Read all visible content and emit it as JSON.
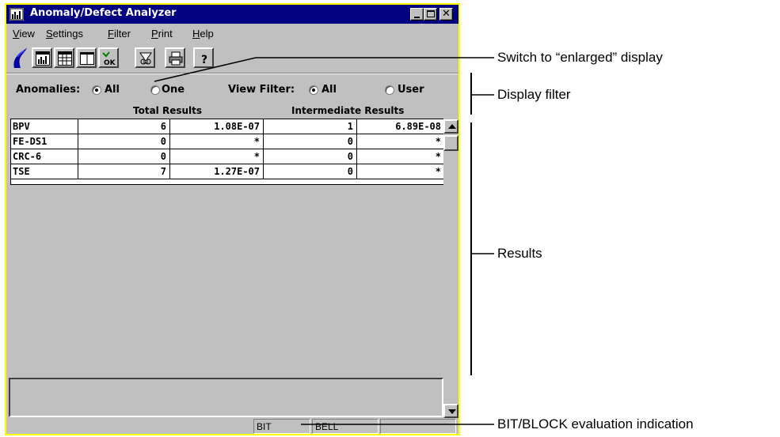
{
  "window": {
    "title": "Anomaly/Defect Analyzer",
    "title_bar_color": "#000080",
    "window_border_color": "#ffff00",
    "controls": [
      "minimize-icon",
      "maximize-icon",
      "close-icon"
    ],
    "close_glyph": "✕"
  },
  "menu": {
    "items": [
      {
        "label": "View",
        "accel": "V",
        "rest": "iew"
      },
      {
        "label": "Settings",
        "accel": "S",
        "rest": "ettings"
      },
      {
        "label": "Filter",
        "accel": "F",
        "rest": "ilter"
      },
      {
        "label": "Print",
        "accel": "P",
        "rest": "rint"
      },
      {
        "label": "Help",
        "accel": "H",
        "rest": "elp"
      }
    ]
  },
  "toolbar": {
    "icons": [
      "histogram-icon",
      "table-icon",
      "enlarge-display-icon",
      "ok-icon",
      "filter-icon",
      "print-icon",
      "help-icon"
    ],
    "ok_text": "OK",
    "help_text": "?"
  },
  "filters": {
    "anomalies_label": "Anomalies:",
    "anomalies_options": [
      {
        "label": "All",
        "checked": true
      },
      {
        "label": "One",
        "checked": false
      }
    ],
    "view_filter_label": "View Filter:",
    "view_filter_options": [
      {
        "label": "All",
        "checked": true
      },
      {
        "label": "User",
        "checked": false
      }
    ]
  },
  "results": {
    "group_headers": [
      "Total Results",
      "Intermediate Results"
    ],
    "rows": [
      {
        "name": "BPV",
        "total_count": "6",
        "total_rate": "1.08E-07",
        "inter_count": "1",
        "inter_rate": "6.89E-08"
      },
      {
        "name": "FE-DS1",
        "total_count": "0",
        "total_rate": "*",
        "inter_count": "0",
        "inter_rate": "*"
      },
      {
        "name": "CRC-6",
        "total_count": "0",
        "total_rate": "*",
        "inter_count": "0",
        "inter_rate": "*"
      },
      {
        "name": "TSE",
        "total_count": "7",
        "total_rate": "1.27E-07",
        "inter_count": "0",
        "inter_rate": "*"
      }
    ]
  },
  "status": {
    "fields": [
      "BIT",
      "BELL",
      ""
    ]
  },
  "callouts": {
    "enlarged_display": "Switch to “enlarged” display",
    "display_filter": "Display filter",
    "results": "Results",
    "bit_block": "BIT/BLOCK evaluation indication"
  }
}
